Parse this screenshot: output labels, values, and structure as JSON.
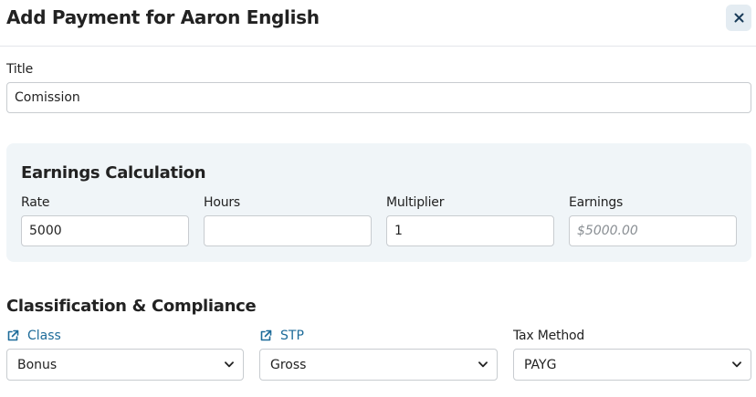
{
  "dialog": {
    "title": "Add Payment for Aaron English",
    "close_label": "×"
  },
  "title_field": {
    "label": "Title",
    "value": "Comission"
  },
  "earnings_calculation": {
    "heading": "Earnings Calculation",
    "rate": {
      "label": "Rate",
      "value": "5000"
    },
    "hours": {
      "label": "Hours",
      "value": ""
    },
    "multiplier": {
      "label": "Multiplier",
      "value": "1"
    },
    "earnings": {
      "label": "Earnings",
      "placeholder": "$5000.00"
    }
  },
  "classification": {
    "heading": "Classification & Compliance",
    "class": {
      "label": "Class",
      "selected": "Bonus"
    },
    "stp": {
      "label": "STP",
      "selected": "Gross"
    },
    "tax_method": {
      "label": "Tax Method",
      "selected": "PAYG"
    }
  },
  "colors": {
    "link": "#1d6b99",
    "panel_bg": "#f0f5f8",
    "close_bg": "#e4ecf2"
  },
  "icons": {
    "close": "close-icon",
    "external_link": "external-link-icon",
    "dropdown": "chevron-down-icon"
  }
}
